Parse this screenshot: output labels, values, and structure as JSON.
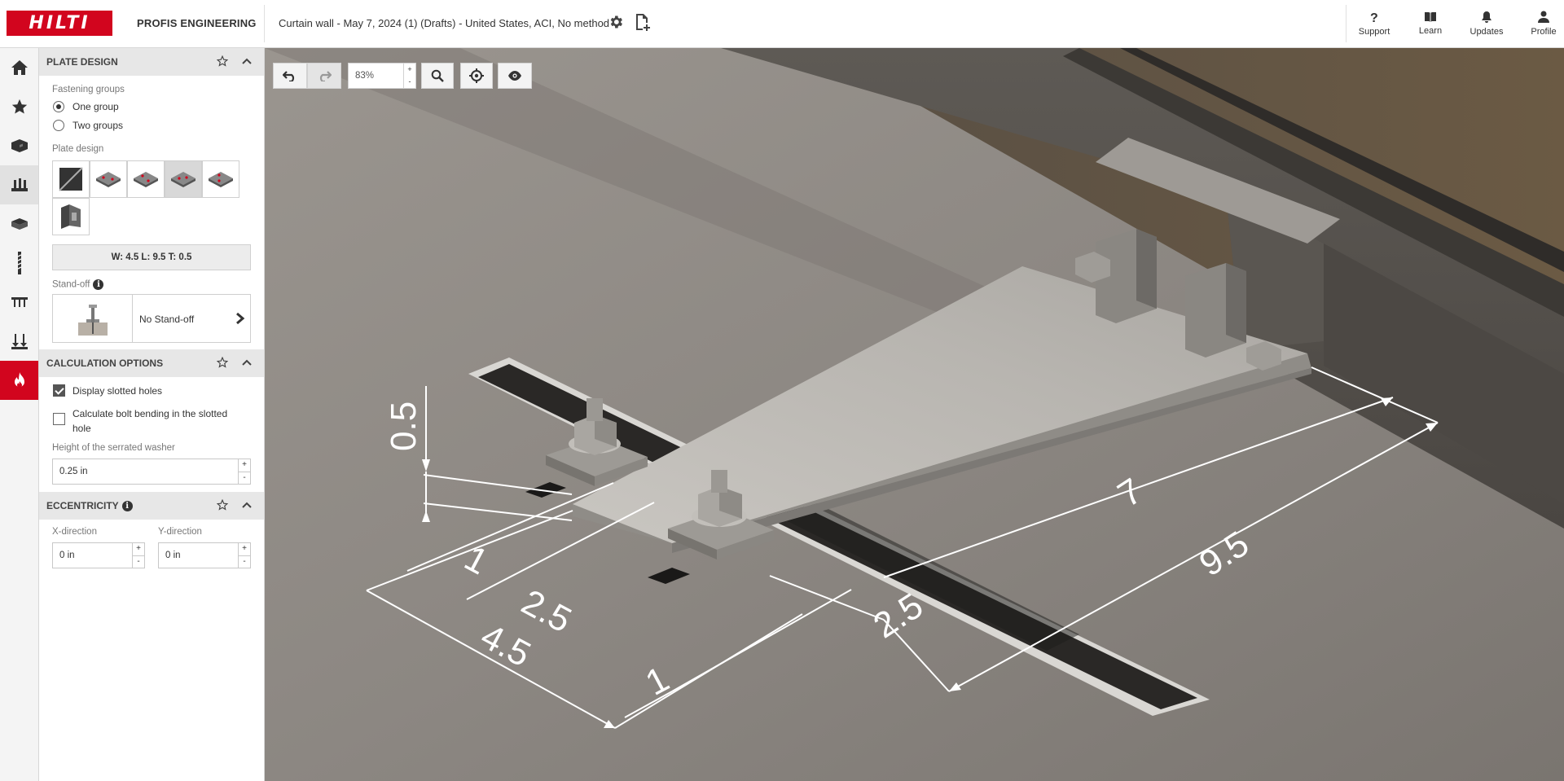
{
  "brand": {
    "logo_text": "HILTI",
    "app_name": "PROFIS ENGINEERING"
  },
  "header": {
    "project_title": "Curtain wall - May 7, 2024 (1) (Drafts) - United States, ACI, No method",
    "icons": [
      "gear-icon",
      "report-export-icon"
    ],
    "right_menu": [
      {
        "label": "Support",
        "icon": "question-icon"
      },
      {
        "label": "Learn",
        "icon": "book-icon"
      },
      {
        "label": "Updates",
        "icon": "bell-icon"
      },
      {
        "label": "Profile",
        "icon": "person-icon"
      }
    ]
  },
  "rail": {
    "items": [
      "home-icon",
      "star-icon",
      "base-material-icon",
      "baseplate-icon",
      "profile-icon",
      "anchor-icon",
      "loads-icon",
      "stand-off-icon",
      "fire-icon"
    ]
  },
  "plate_design": {
    "title": "PLATE DESIGN",
    "fastening_groups_label": "Fastening groups",
    "options": [
      "One group",
      "Two groups"
    ],
    "selected_option": "One group",
    "plate_design_label": "Plate design",
    "selected_tile": 4,
    "dimensions": "W: 4.5 L: 9.5 T: 0.5",
    "standoff_label": "Stand-off",
    "standoff_value": "No Stand-off"
  },
  "calc_options": {
    "title": "CALCULATION OPTIONS",
    "display_slotted_holes": "Display slotted holes",
    "display_slotted_holes_checked": true,
    "calc_bolt_bending": "Calculate bolt bending in the slotted hole",
    "calc_bolt_bending_line1": "Calculate bolt bending in the slotted",
    "calc_bolt_bending_line2": "hole",
    "calc_bolt_bending_checked": false,
    "serrated_washer_label": "Height of the serrated washer",
    "serrated_washer_value": "0.25 in"
  },
  "eccentricity": {
    "title": "ECCENTRICITY",
    "x_label": "X-direction",
    "x_value": "0 in",
    "y_label": "Y-direction",
    "y_value": "0 in"
  },
  "viewport": {
    "zoom": "83%",
    "tools": [
      "undo-icon",
      "redo-icon",
      "search-icon",
      "crosshair-icon",
      "eye-icon"
    ],
    "dimensions": {
      "thickness": "0.5",
      "edge_1a": "1",
      "spacing_a": "2.5",
      "width": "4.5",
      "edge_1b": "1",
      "spacing_b": "2.5",
      "inner": "7",
      "length": "9.5"
    }
  },
  "colors": {
    "brand_red": "#d2051e",
    "panel_header": "#e7e7e7",
    "concrete": "#8a8580",
    "steel": "#b9b7b2"
  }
}
